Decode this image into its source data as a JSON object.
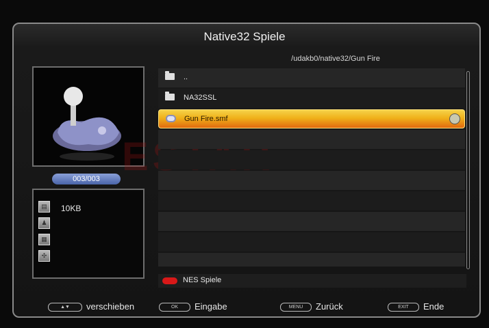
{
  "header": {
    "title": "Native32 Spiele",
    "path": "/udakb0/native32/Gun Fire"
  },
  "preview": {
    "counter": "003/003"
  },
  "info": {
    "size": "10KB"
  },
  "files": [
    {
      "label": "..",
      "icon": "folder-icon"
    },
    {
      "label": "NA32SSL",
      "icon": "folder-icon"
    },
    {
      "label": "Gun Fire.smf",
      "icon": "file-icon",
      "selected": true
    }
  ],
  "bottom_bar": {
    "nes_label": "NES Spiele"
  },
  "footer": {
    "move_key": "▲▼",
    "move_label": "verschieben",
    "ok_key": "OK",
    "ok_label": "Eingabe",
    "menu_key": "MENU",
    "menu_label": "Zurück",
    "exit_key": "EXIT",
    "exit_label": "Ende"
  },
  "colors": {
    "selection": "#f0b11a",
    "counter": "#6a82c4",
    "red_button": "#d81818"
  }
}
